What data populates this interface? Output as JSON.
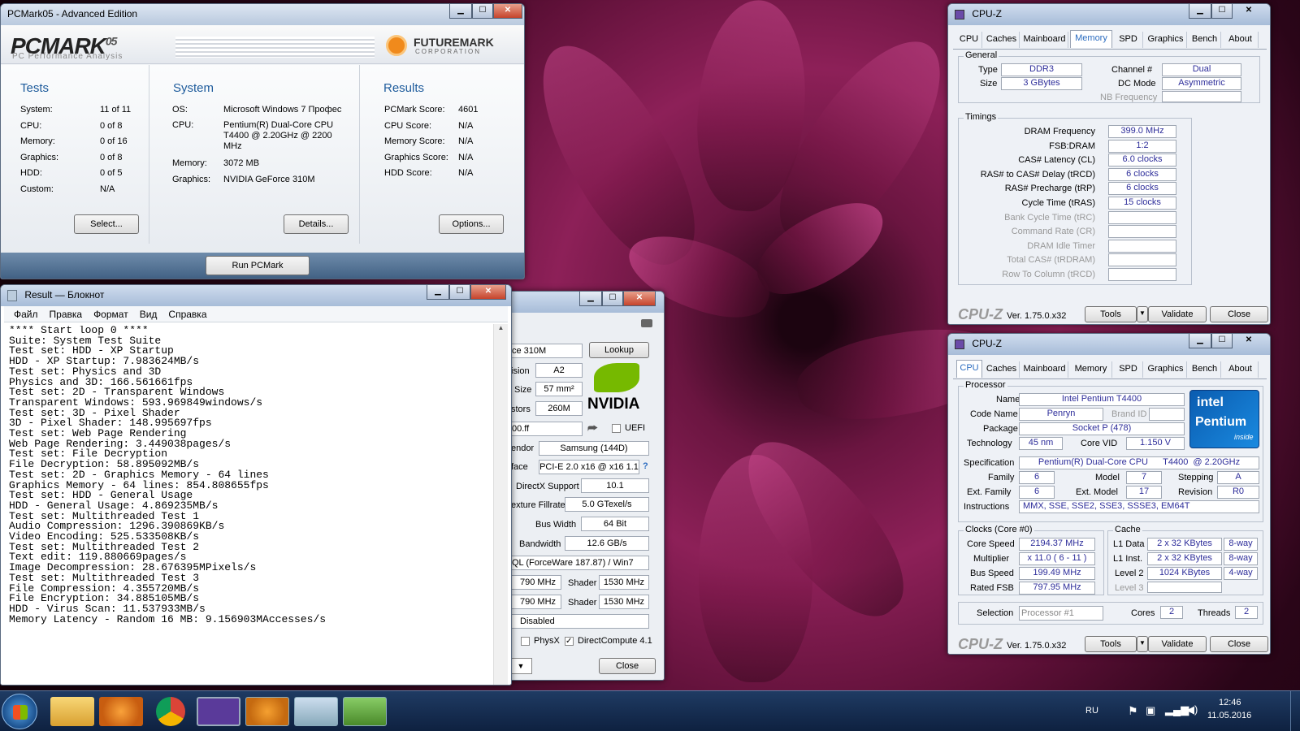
{
  "pcmark": {
    "title": "PCMark05 - Advanced Edition",
    "logo": "PCMARK",
    "logo_ver": "05",
    "logo_sub": "PC Performance Analysis",
    "fm1": "FUTUREMARK",
    "fm2": "CORPORATION",
    "tests_h": "Tests",
    "system_h": "System",
    "results_h": "Results",
    "tests": [
      [
        "System:",
        "11 of 11"
      ],
      [
        "CPU:",
        "0 of 8"
      ],
      [
        "Memory:",
        "0 of 16"
      ],
      [
        "Graphics:",
        "0 of 8"
      ],
      [
        "HDD:",
        "0 of 5"
      ],
      [
        "Custom:",
        "N/A"
      ]
    ],
    "system": [
      [
        "OS:",
        "Microsoft Windows 7 Профес"
      ],
      [
        "CPU:",
        "Pentium(R) Dual-Core CPU"
      ],
      [
        "",
        "T4400  @ 2.20GHz @ 2200"
      ],
      [
        "",
        "MHz"
      ],
      [
        "Memory:",
        "3072 MB"
      ],
      [
        "Graphics:",
        "NVIDIA GeForce 310M"
      ]
    ],
    "results": [
      [
        "PCMark Score:",
        "4601"
      ],
      [
        "CPU Score:",
        "N/A"
      ],
      [
        "Memory Score:",
        "N/A"
      ],
      [
        "Graphics Score:",
        "N/A"
      ],
      [
        "HDD Score:",
        "N/A"
      ]
    ],
    "select": "Select...",
    "details": "Details...",
    "options": "Options...",
    "run": "Run PCMark"
  },
  "notepad": {
    "title": "Result — Блокнот",
    "menu": [
      "Файл",
      "Правка",
      "Формат",
      "Вид",
      "Справка"
    ],
    "lines": [
      "**** Start loop 0 ****",
      "Suite: System Test Suite",
      "Test set: HDD - XP Startup",
      "HDD - XP Startup: 7.983624MB/s",
      "Test set: Physics and 3D",
      "Physics and 3D: 166.561661fps",
      "Test set: 2D - Transparent Windows",
      "Transparent Windows: 593.969849windows/s",
      "Test set: 3D - Pixel Shader",
      "3D - Pixel Shader: 148.995697fps",
      "Test set: Web Page Rendering",
      "Web Page Rendering: 3.449038pages/s",
      "Test set: File Decryption",
      "File Decryption: 58.895092MB/s",
      "Test set: 2D - Graphics Memory - 64 lines",
      "Graphics Memory - 64 lines: 854.808655fps",
      "Test set: HDD - General Usage",
      "HDD - General Usage: 4.869235MB/s",
      "Test set: Multithreaded Test 1",
      "Audio Compression: 1296.390869KB/s",
      "Video Encoding: 525.533508KB/s",
      "Test set: Multithreaded Test 2",
      "Text edit: 119.880669pages/s",
      "Image Decompression: 28.676395MPixels/s",
      "Test set: Multithreaded Test 3",
      "File Compression: 4.355720MB/s",
      "File Encryption: 34.885105MB/s",
      "HDD - Virus Scan: 11.537933MB/s",
      "Memory Latency - Random 16 MB: 9.156903MAccesses/s"
    ]
  },
  "gpuz": {
    "name_frag": "ce 310M",
    "lookup": "Lookup",
    "rev_l": "ision",
    "rev": "A2",
    "die_l": "Size",
    "die": "57 mm²",
    "trans_l": "stors",
    "trans": "260M",
    "bios": "00.ff",
    "uefi": "UEFI",
    "vendor_l": "endor",
    "vendor": "Samsung (144D)",
    "bus_l": "face",
    "bus": "PCI-E 2.0 x16 @ x16 1.1",
    "q": "?",
    "dx_l": "DirectX Support",
    "dx": "10.1",
    "fill_l": "exture Fillrate",
    "fill": "5.0 GTexel/s",
    "bw_l": "Bus Width",
    "bw": "64 Bit",
    "band_l": "Bandwidth",
    "band": "12.6 GB/s",
    "drv": "QL (ForceWare 187.87) / Win7",
    "clk1": "790 MHz",
    "sh1_l": "Shader",
    "sh1": "1530 MHz",
    "clk2": "790 MHz",
    "sh2_l": "Shader",
    "sh2": "1530 MHz",
    "sli": "Disabled",
    "physx": "PhysX",
    "dc": "DirectCompute 4.1",
    "close": "Close",
    "nvidia": "NVIDIA"
  },
  "cpuz_mem": {
    "title": "CPU-Z",
    "tabs": [
      "CPU",
      "Caches",
      "Mainboard",
      "Memory",
      "SPD",
      "Graphics",
      "Bench",
      "About"
    ],
    "active": 3,
    "general": "General",
    "type_l": "Type",
    "type": "DDR3",
    "size_l": "Size",
    "size": "3 GBytes",
    "ch_l": "Channel #",
    "ch": "Dual",
    "dc_l": "DC Mode",
    "dc": "Asymmetric",
    "nb_l": "NB Frequency",
    "timings": "Timings",
    "rows": [
      [
        "DRAM Frequency",
        "399.0 MHz",
        0
      ],
      [
        "FSB:DRAM",
        "1:2",
        0
      ],
      [
        "CAS# Latency (CL)",
        "6.0 clocks",
        0
      ],
      [
        "RAS# to CAS# Delay (tRCD)",
        "6 clocks",
        0
      ],
      [
        "RAS# Precharge (tRP)",
        "6 clocks",
        0
      ],
      [
        "Cycle Time (tRAS)",
        "15 clocks",
        0
      ],
      [
        "Bank Cycle Time (tRC)",
        "",
        1
      ],
      [
        "Command Rate (CR)",
        "",
        1
      ],
      [
        "DRAM Idle Timer",
        "",
        1
      ],
      [
        "Total CAS# (tRDRAM)",
        "",
        1
      ],
      [
        "Row To Column (tRCD)",
        "",
        1
      ]
    ],
    "brand": "CPU-Z",
    "ver": "Ver. 1.75.0.x32",
    "tools": "Tools",
    "validate": "Validate",
    "close": "Close"
  },
  "cpuz_cpu": {
    "title": "CPU-Z",
    "tabs": [
      "CPU",
      "Caches",
      "Mainboard",
      "Memory",
      "SPD",
      "Graphics",
      "Bench",
      "About"
    ],
    "active": 0,
    "processor": "Processor",
    "name_l": "Name",
    "name": "Intel Pentium T4400",
    "code_l": "Code Name",
    "code": "Penryn",
    "brand_l": "Brand ID",
    "pkg_l": "Package",
    "pkg": "Socket P (478)",
    "tech_l": "Technology",
    "tech": "45 nm",
    "vid_l": "Core VID",
    "vid": "1.150 V",
    "spec_l": "Specification",
    "spec": "Pentium(R) Dual-Core CPU      T4400  @ 2.20GHz",
    "fam_l": "Family",
    "fam": "6",
    "model_l": "Model",
    "model": "7",
    "step_l": "Stepping",
    "step": "A",
    "efam_l": "Ext. Family",
    "efam": "6",
    "emodel_l": "Ext. Model",
    "emodel": "17",
    "rev_l": "Revision",
    "rev": "R0",
    "inst_l": "Instructions",
    "inst": "MMX, SSE, SSE2, SSE3, SSSE3, EM64T",
    "intel": "intel",
    "pentium": "Pentium",
    "inside": "inside",
    "clocks": "Clocks (Core #0)",
    "cs_l": "Core Speed",
    "cs": "2194.37 MHz",
    "mul_l": "Multiplier",
    "mul": "x 11.0 ( 6 - 11 )",
    "bs_l": "Bus Speed",
    "bs": "199.49 MHz",
    "rf_l": "Rated FSB",
    "rf": "797.95 MHz",
    "cache": "Cache",
    "l1d_l": "L1 Data",
    "l1d": "2 x 32 KBytes",
    "l1d_w": "8-way",
    "l1i_l": "L1 Inst.",
    "l1i": "2 x 32 KBytes",
    "l1i_w": "8-way",
    "l2_l": "Level 2",
    "l2": "1024 KBytes",
    "l2_w": "4-way",
    "l3_l": "Level 3",
    "sel_l": "Selection",
    "sel": "Processor #1",
    "cores_l": "Cores",
    "cores": "2",
    "threads_l": "Threads",
    "threads": "2",
    "brand": "CPU-Z",
    "ver": "Ver. 1.75.0.x32",
    "tools": "Tools",
    "validate": "Validate",
    "close": "Close"
  },
  "taskbar": {
    "lang": "RU",
    "time": "12:46",
    "date": "11.05.2016"
  }
}
